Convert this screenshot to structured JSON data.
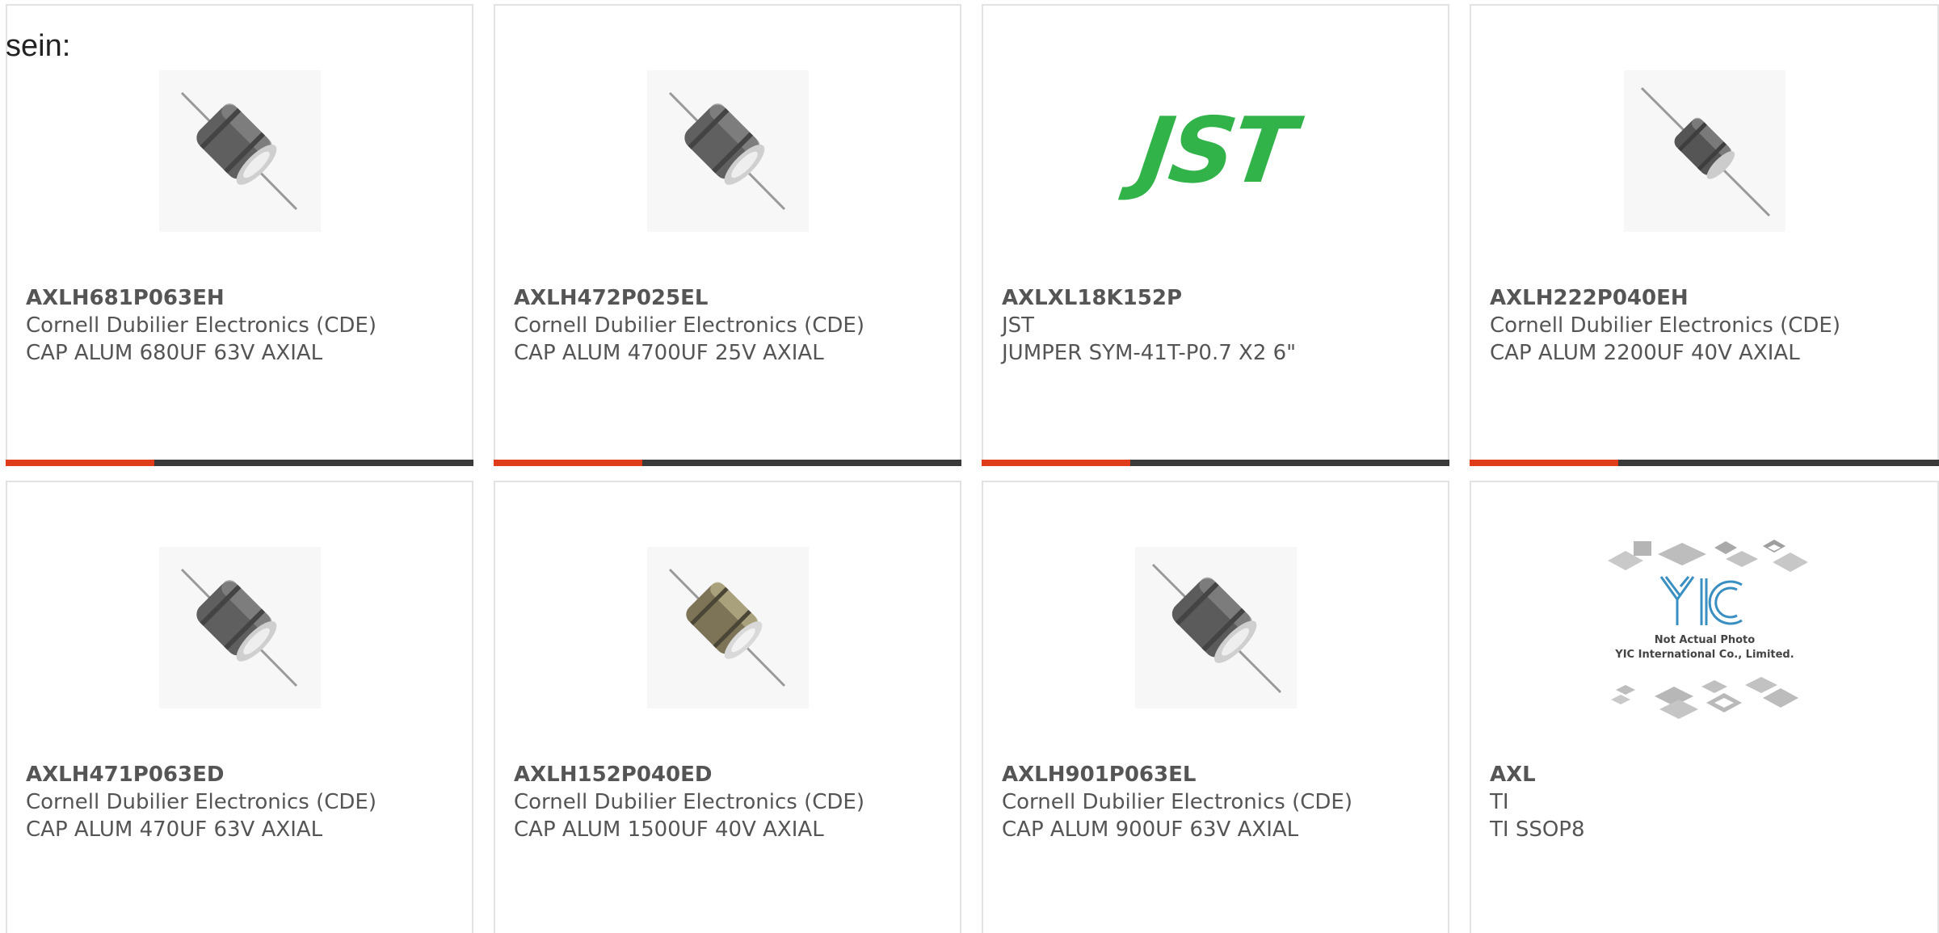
{
  "intro_text": "sein:",
  "colors": {
    "accent": "#e03c1a",
    "bar": "#3a3a3a",
    "border": "#e2e2e2",
    "text": "#555555",
    "jst_green": "#31b34a"
  },
  "products": [
    {
      "part_number": "AXLH681P063EH",
      "manufacturer": "Cornell Dubilier Electronics (CDE)",
      "description": "CAP ALUM 680UF 63V AXIAL",
      "image": "axial-capacitor-icon"
    },
    {
      "part_number": "AXLH472P025EL",
      "manufacturer": "Cornell Dubilier Electronics (CDE)",
      "description": "CAP ALUM 4700UF 25V AXIAL",
      "image": "axial-capacitor-icon"
    },
    {
      "part_number": "AXLXL18K152P",
      "manufacturer": "JST",
      "description": "JUMPER SYM-41T-P0.7 X2 6\"",
      "image": "jst-logo",
      "logo_text": "JST"
    },
    {
      "part_number": "AXLH222P040EH",
      "manufacturer": "Cornell Dubilier Electronics (CDE)",
      "description": "CAP ALUM 2200UF 40V AXIAL",
      "image": "axial-capacitor-icon"
    },
    {
      "part_number": "AXLH471P063ED",
      "manufacturer": "Cornell Dubilier Electronics (CDE)",
      "description": "CAP ALUM 470UF 63V AXIAL",
      "image": "axial-capacitor-icon"
    },
    {
      "part_number": "AXLH152P040ED",
      "manufacturer": "Cornell Dubilier Electronics (CDE)",
      "description": "CAP ALUM 1500UF 40V AXIAL",
      "image": "axial-capacitor-icon"
    },
    {
      "part_number": "AXLH901P063EL",
      "manufacturer": "Cornell Dubilier Electronics (CDE)",
      "description": "CAP ALUM 900UF 63V AXIAL",
      "image": "axial-capacitor-icon"
    },
    {
      "part_number": "AXL",
      "manufacturer": "TI",
      "description": "TI SSOP8",
      "image": "yic-placeholder-image",
      "placeholder_line1": "Not Actual Photo",
      "placeholder_line2": "YIC International Co., Limited."
    }
  ]
}
